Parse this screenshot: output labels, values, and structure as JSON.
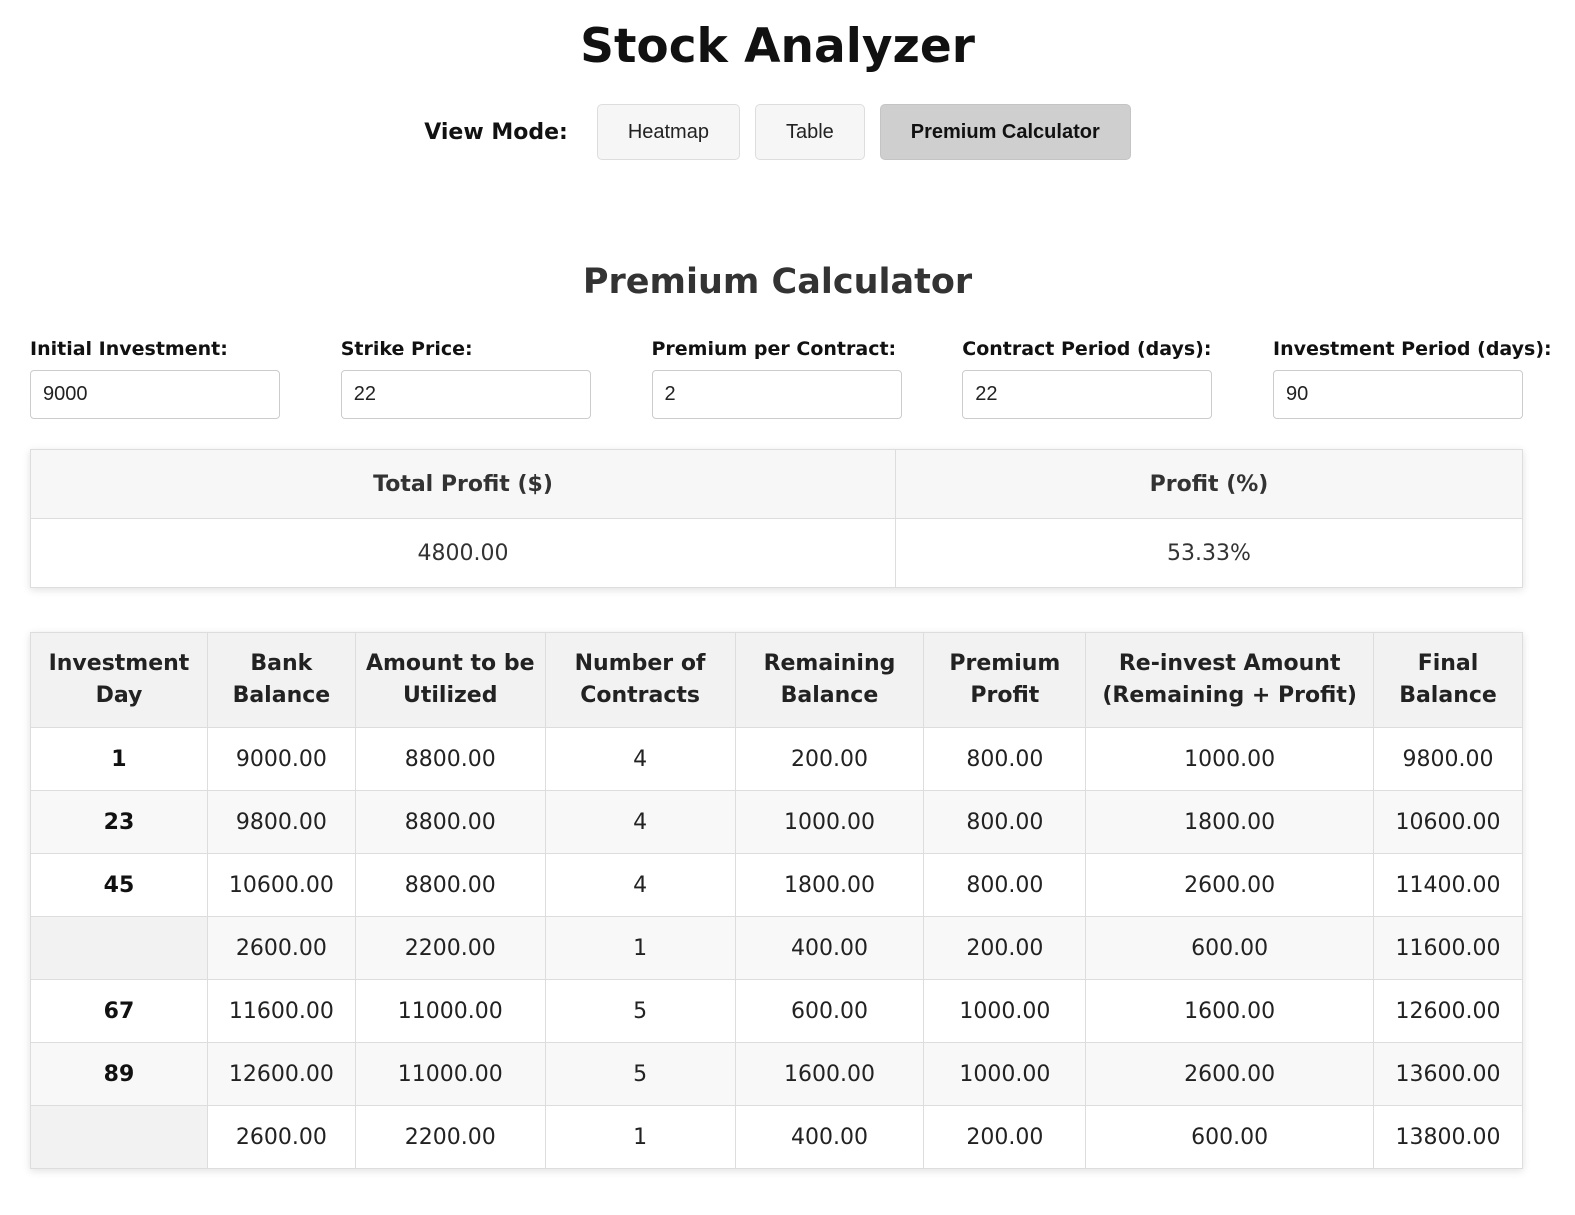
{
  "app": {
    "title": "Stock Analyzer"
  },
  "view_mode": {
    "label": "View Mode:",
    "buttons": [
      {
        "label": "Heatmap",
        "active": false
      },
      {
        "label": "Table",
        "active": false
      },
      {
        "label": "Premium Calculator",
        "active": true
      }
    ]
  },
  "calculator": {
    "title": "Premium Calculator",
    "fields": {
      "initial_investment": {
        "label": "Initial Investment:",
        "value": "9000"
      },
      "strike_price": {
        "label": "Strike Price:",
        "value": "22"
      },
      "premium_per_contract": {
        "label": "Premium per Contract:",
        "value": "2"
      },
      "contract_period": {
        "label": "Contract Period (days):",
        "value": "22"
      },
      "investment_period": {
        "label": "Investment Period (days):",
        "value": "90"
      }
    },
    "summary": {
      "headers": [
        "Total Profit ($)",
        "Profit (%)"
      ],
      "values": [
        "4800.00",
        "53.33%"
      ]
    },
    "table": {
      "headers": [
        "Investment Day",
        "Bank Balance",
        "Amount to be Utilized",
        "Number of Contracts",
        "Remaining Balance",
        "Premium Profit",
        "Re-invest Amount (Remaining + Profit)",
        "Final Balance"
      ],
      "rows": [
        [
          "1",
          "9000.00",
          "8800.00",
          "4",
          "200.00",
          "800.00",
          "1000.00",
          "9800.00"
        ],
        [
          "23",
          "9800.00",
          "8800.00",
          "4",
          "1000.00",
          "800.00",
          "1800.00",
          "10600.00"
        ],
        [
          "45",
          "10600.00",
          "8800.00",
          "4",
          "1800.00",
          "800.00",
          "2600.00",
          "11400.00"
        ],
        [
          "",
          "2600.00",
          "2200.00",
          "1",
          "400.00",
          "200.00",
          "600.00",
          "11600.00"
        ],
        [
          "67",
          "11600.00",
          "11000.00",
          "5",
          "600.00",
          "1000.00",
          "1600.00",
          "12600.00"
        ],
        [
          "89",
          "12600.00",
          "11000.00",
          "5",
          "1600.00",
          "1000.00",
          "2600.00",
          "13600.00"
        ],
        [
          "",
          "2600.00",
          "2200.00",
          "1",
          "400.00",
          "200.00",
          "600.00",
          "13800.00"
        ]
      ]
    }
  }
}
